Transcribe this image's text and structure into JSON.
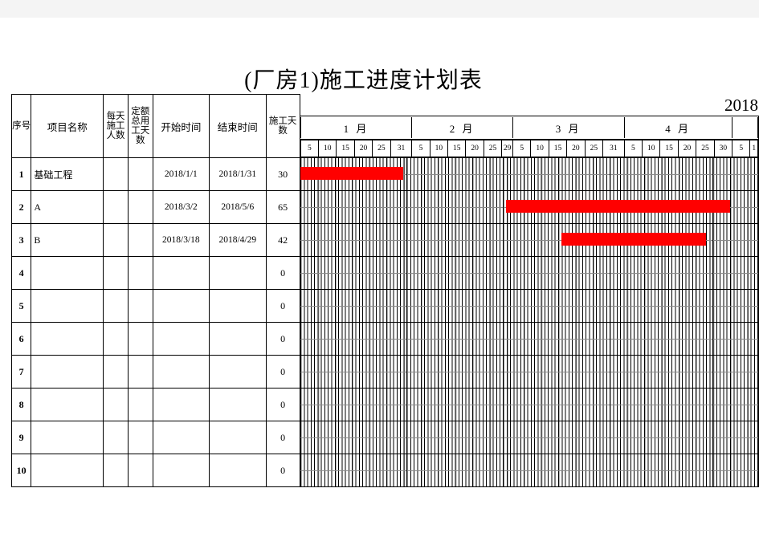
{
  "document": {
    "title": "(厂房1)施工进度计划表",
    "year_label": "2018"
  },
  "table": {
    "headers": {
      "seq": "序号",
      "name": "项目名称",
      "daily_workers": "每天施工人数",
      "quota_total_days": "定额总用工天数",
      "start_time": "开始时间",
      "end_time": "结束时间",
      "work_days": "施工天数"
    },
    "months": [
      {
        "label": "1 月",
        "days": 31,
        "ticks": [
          "5",
          "10",
          "15",
          "20",
          "25",
          "31"
        ]
      },
      {
        "label": "2 月",
        "days": 28,
        "ticks": [
          "5",
          "10",
          "15",
          "20",
          "25",
          "29"
        ]
      },
      {
        "label": "3 月",
        "days": 31,
        "ticks": [
          "5",
          "10",
          "15",
          "20",
          "25",
          "31"
        ]
      },
      {
        "label": "4 月",
        "days": 30,
        "ticks": [
          "5",
          "10",
          "15",
          "20",
          "25",
          "30"
        ]
      },
      {
        "label": "",
        "days": 7,
        "ticks": [
          "5",
          "1"
        ]
      }
    ],
    "rows": [
      {
        "seq": "1",
        "name": "基础工程",
        "daily_workers": "",
        "quota_total_days": "",
        "start": "2018/1/1",
        "end": "2018/1/31",
        "days": "30"
      },
      {
        "seq": "2",
        "name": "A",
        "daily_workers": "",
        "quota_total_days": "",
        "start": "2018/3/2",
        "end": "2018/5/6",
        "days": "65"
      },
      {
        "seq": "3",
        "name": "B",
        "daily_workers": "",
        "quota_total_days": "",
        "start": "2018/3/18",
        "end": "2018/4/29",
        "days": "42"
      },
      {
        "seq": "4",
        "name": "",
        "daily_workers": "",
        "quota_total_days": "",
        "start": "",
        "end": "",
        "days": "0"
      },
      {
        "seq": "5",
        "name": "",
        "daily_workers": "",
        "quota_total_days": "",
        "start": "",
        "end": "",
        "days": "0"
      },
      {
        "seq": "6",
        "name": "",
        "daily_workers": "",
        "quota_total_days": "",
        "start": "",
        "end": "",
        "days": "0"
      },
      {
        "seq": "7",
        "name": "",
        "daily_workers": "",
        "quota_total_days": "",
        "start": "",
        "end": "",
        "days": "0"
      },
      {
        "seq": "8",
        "name": "",
        "daily_workers": "",
        "quota_total_days": "",
        "start": "",
        "end": "",
        "days": "0"
      },
      {
        "seq": "9",
        "name": "",
        "daily_workers": "",
        "quota_total_days": "",
        "start": "",
        "end": "",
        "days": "0"
      },
      {
        "seq": "10",
        "name": "",
        "daily_workers": "",
        "quota_total_days": "",
        "start": "",
        "end": "",
        "days": "0"
      }
    ]
  },
  "chart_data": {
    "type": "bar",
    "chart_kind": "gantt",
    "title": "(厂房1)施工进度计划表",
    "xlabel": "2018",
    "ylabel": "",
    "timeline_start": "2018/1/1",
    "timeline_visible_end": "2018/5/7",
    "categories": [
      "基础工程",
      "A",
      "B"
    ],
    "tasks": [
      {
        "name": "基础工程",
        "start": "2018/1/1",
        "end": "2018/1/31",
        "duration_days": 30,
        "start_day_index": 0,
        "bar_color": "#ff0000"
      },
      {
        "name": "A",
        "start": "2018/3/2",
        "end": "2018/5/6",
        "duration_days": 65,
        "start_day_index": 60,
        "bar_color": "#ff0000"
      },
      {
        "name": "B",
        "start": "2018/3/18",
        "end": "2018/4/29",
        "duration_days": 42,
        "start_day_index": 76,
        "bar_color": "#ff0000"
      }
    ],
    "values": [
      30,
      65,
      42
    ],
    "legend": [],
    "grid": true,
    "axis_ticks": [
      "5",
      "10",
      "15",
      "20",
      "25",
      "31",
      "5",
      "10",
      "15",
      "20",
      "25",
      "29",
      "5",
      "10",
      "15",
      "20",
      "25",
      "31",
      "5",
      "10",
      "15",
      "20",
      "25",
      "30",
      "5",
      "1"
    ]
  },
  "colors": {
    "bar": "#ff0000",
    "grid_major": "#000000",
    "grid_minor": "#9c9c9c",
    "page_background": "#f4f4f4",
    "sheet_background": "#ffffff"
  }
}
